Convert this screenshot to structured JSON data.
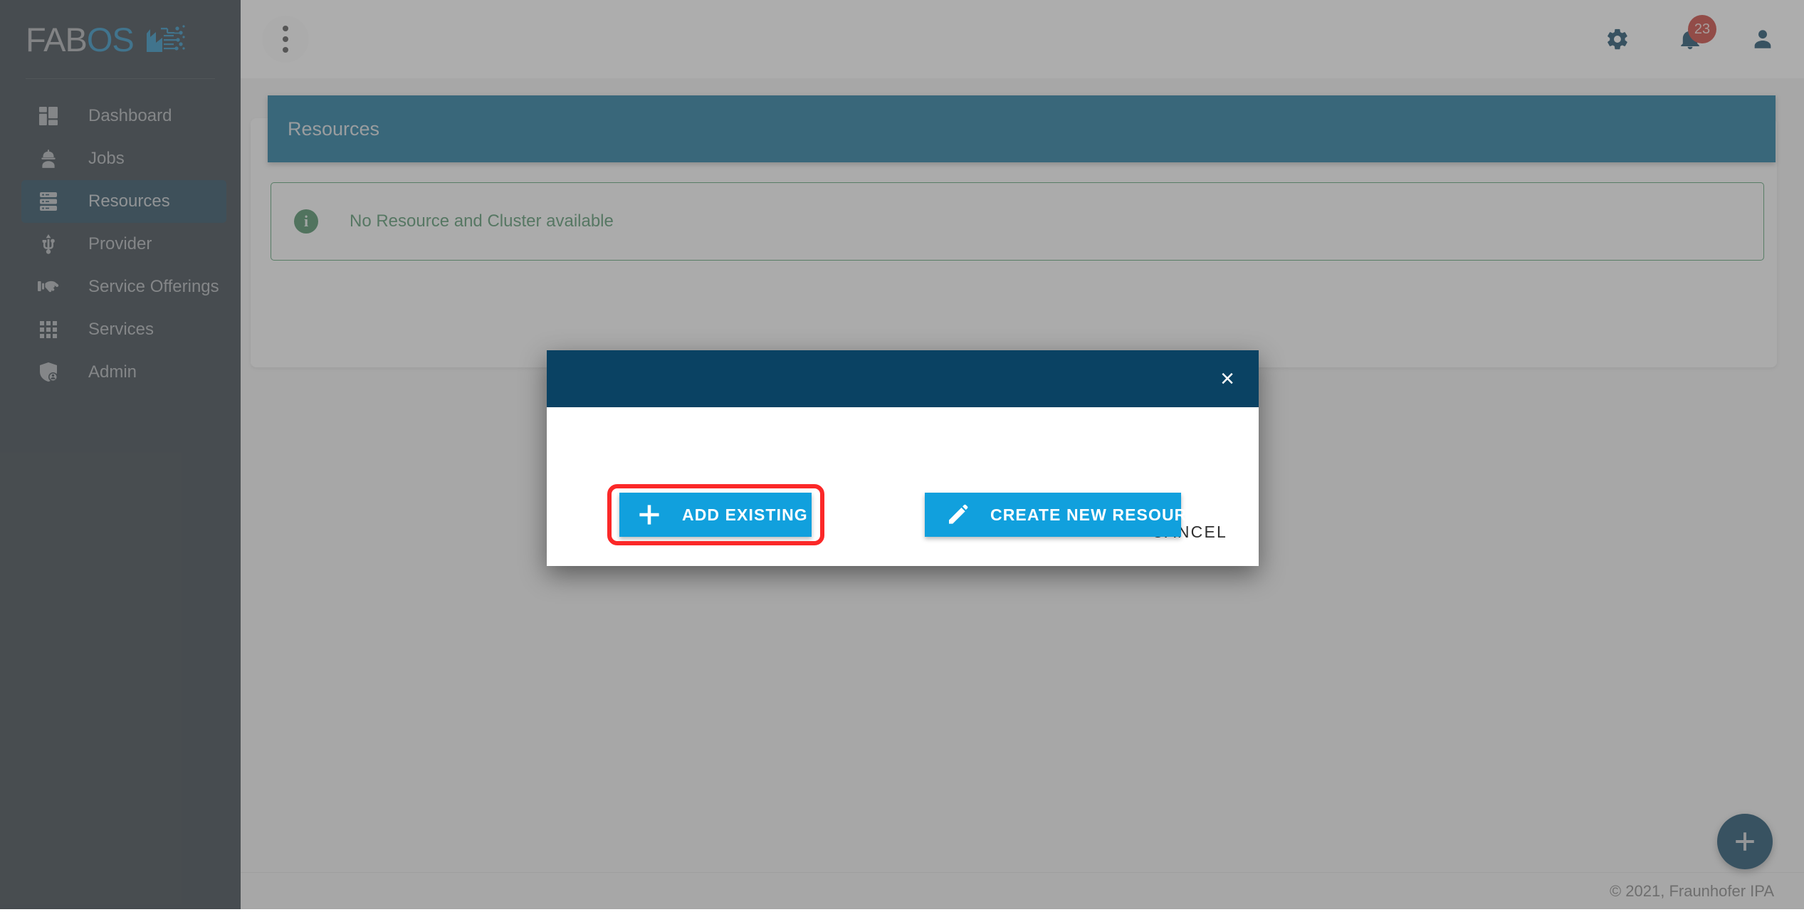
{
  "brand": {
    "logo_fab": "FAB",
    "logo_os": "OS",
    "logo_mark_icon": "factory-circuit-icon"
  },
  "sidebar": {
    "items": [
      {
        "label": "Dashboard",
        "icon": "dashboard-grid-icon",
        "active": false
      },
      {
        "label": "Jobs",
        "icon": "worker-helmet-icon",
        "active": false
      },
      {
        "label": "Resources",
        "icon": "server-stack-icon",
        "active": true
      },
      {
        "label": "Provider",
        "icon": "usb-plug-icon",
        "active": false
      },
      {
        "label": "Service Offerings",
        "icon": "hand-offer-icon",
        "active": false
      },
      {
        "label": "Services",
        "icon": "dots-grid-icon",
        "active": false
      },
      {
        "label": "Admin",
        "icon": "shield-user-icon",
        "active": false
      }
    ]
  },
  "topbar": {
    "kebab_menu_name": "more-options-icon",
    "settings_icon": "gear-icon",
    "notifications_icon": "bell-icon",
    "notifications_count": "23",
    "account_icon": "person-icon"
  },
  "page": {
    "title": "Resources",
    "alert": {
      "icon": "info-circle-icon",
      "icon_glyph": "i",
      "text": "No Resource and Cluster available"
    }
  },
  "fab": {
    "icon": "plus-icon",
    "name": "add-resource-fab"
  },
  "footer": {
    "copyright": "© 2021, Fraunhofer IPA"
  },
  "dialog": {
    "close_label": "×",
    "buttons": [
      {
        "label": "ADD EXISTING",
        "icon": "plus-icon",
        "highlighted": true
      },
      {
        "label": "CREATE NEW RESOURCE",
        "icon": "pencil-icon",
        "highlighted": false
      }
    ],
    "cancel_label": "CANCEL"
  },
  "colors": {
    "sidebar_bg": "#2b363d",
    "sidebar_active": "#173d52",
    "title_bar": "#0e6e95",
    "dialog_header": "#0a4263",
    "accent_blue": "#11a0dd",
    "brand_blue": "#1f88bd",
    "alert_green": "#4a8e65",
    "badge_red": "#c7352c",
    "highlight_red": "#fb2828",
    "fab_navy": "#0c4260"
  }
}
